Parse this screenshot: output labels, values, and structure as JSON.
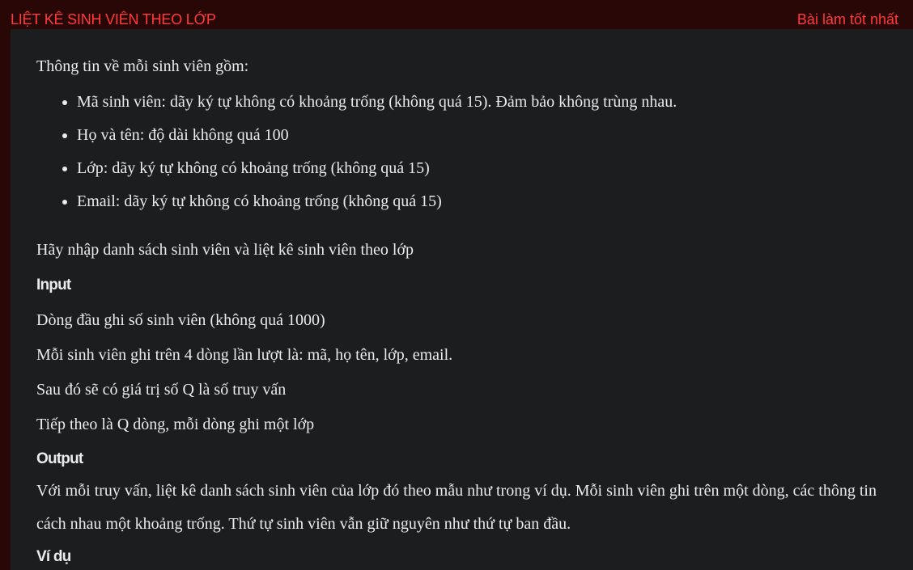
{
  "header": {
    "title": "LIỆT KÊ SINH VIÊN THEO LỚP",
    "best_link": "Bài làm tốt nhất"
  },
  "problem": {
    "intro": "Thông tin về mỗi sinh viên gồm:",
    "fields": [
      "Mã sinh viên: dãy ký tự không có khoảng trống (không quá 15). Đảm bảo không trùng nhau.",
      "Họ và tên: độ dài không quá 100",
      "Lớp: dãy ký tự không có khoảng trống (không quá 15)",
      "Email: dãy ký tự không có khoảng trống (không quá 15)"
    ],
    "task": "Hãy nhập danh sách sinh viên và liệt kê sinh viên theo lớp",
    "input_heading": "Input",
    "input_lines": [
      "Dòng đầu ghi số sinh viên (không quá 1000)",
      "Mỗi sinh viên ghi trên 4 dòng lần lượt là: mã, họ tên, lớp, email.",
      "Sau đó sẽ có giá trị số Q là số truy vấn",
      "Tiếp theo là Q dòng, mỗi dòng ghi một lớp"
    ],
    "output_heading": "Output",
    "output_text": "Với mỗi truy vấn, liệt kê danh sách sinh viên của lớp đó theo mẫu như trong ví dụ. Mỗi sinh viên ghi trên một dòng, các thông tin cách nhau một khoảng trống. Thứ tự sinh viên vẫn giữ nguyên như thứ tự ban đầu.",
    "example_heading": "Ví dụ"
  },
  "colors": {
    "header_bg": "#2a0707",
    "accent": "#ff3b3b",
    "panel_bg": "#1c1d1f",
    "text": "#ebebeb"
  }
}
